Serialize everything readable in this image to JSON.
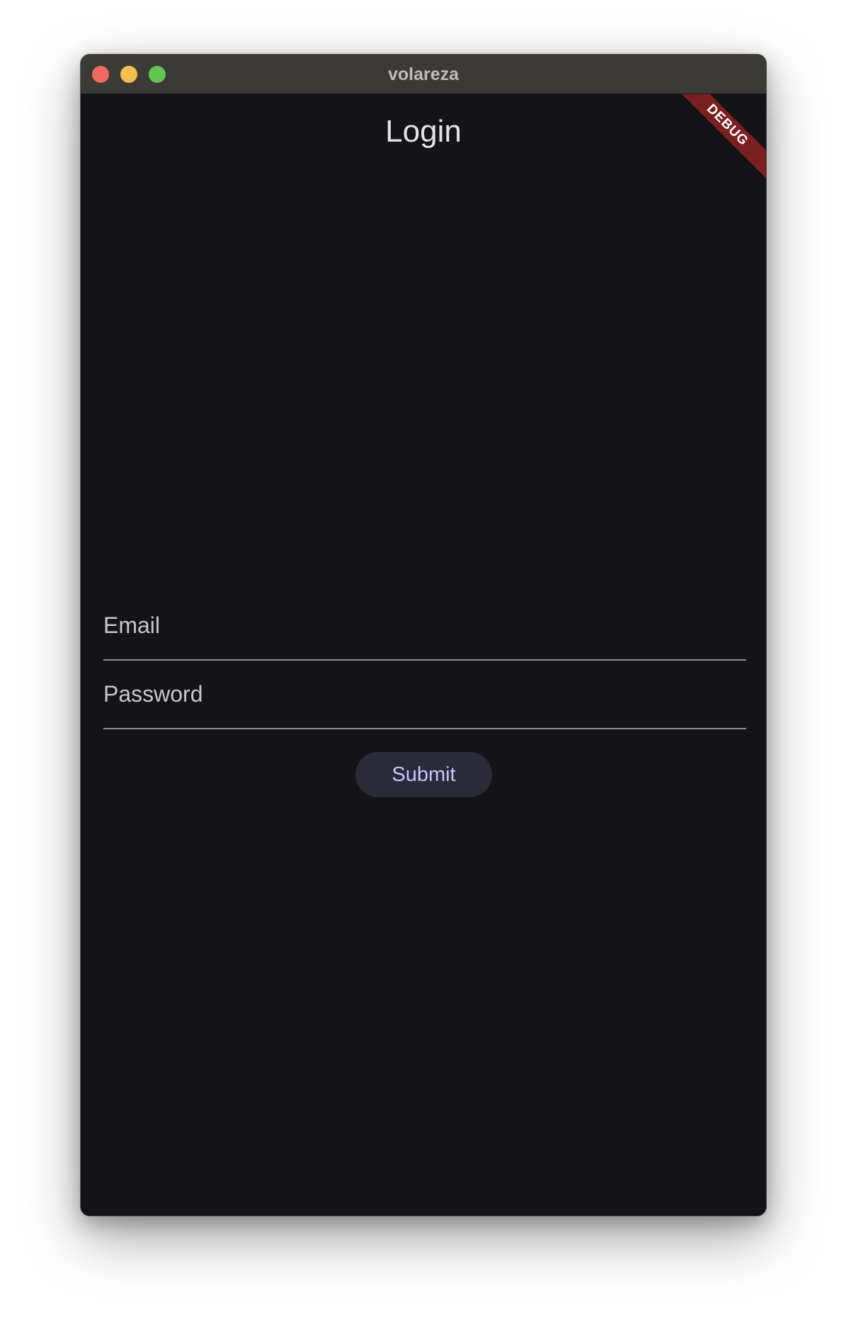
{
  "window": {
    "title": "volareza",
    "controls": {
      "close_color": "#ed6a5e",
      "minimize_color": "#f5bf4f",
      "zoom_color": "#61c554"
    }
  },
  "page": {
    "title": "Login"
  },
  "debug_banner": {
    "label": "DEBUG"
  },
  "form": {
    "email": {
      "placeholder": "Email",
      "value": ""
    },
    "password": {
      "placeholder": "Password",
      "value": ""
    },
    "submit_label": "Submit"
  },
  "colors": {
    "background": "#131318",
    "titlebar": "#3c3a37",
    "accent_text": "#c6c4ff",
    "button_bg": "#2a2a38",
    "debug_ribbon": "#7a1f1f"
  }
}
